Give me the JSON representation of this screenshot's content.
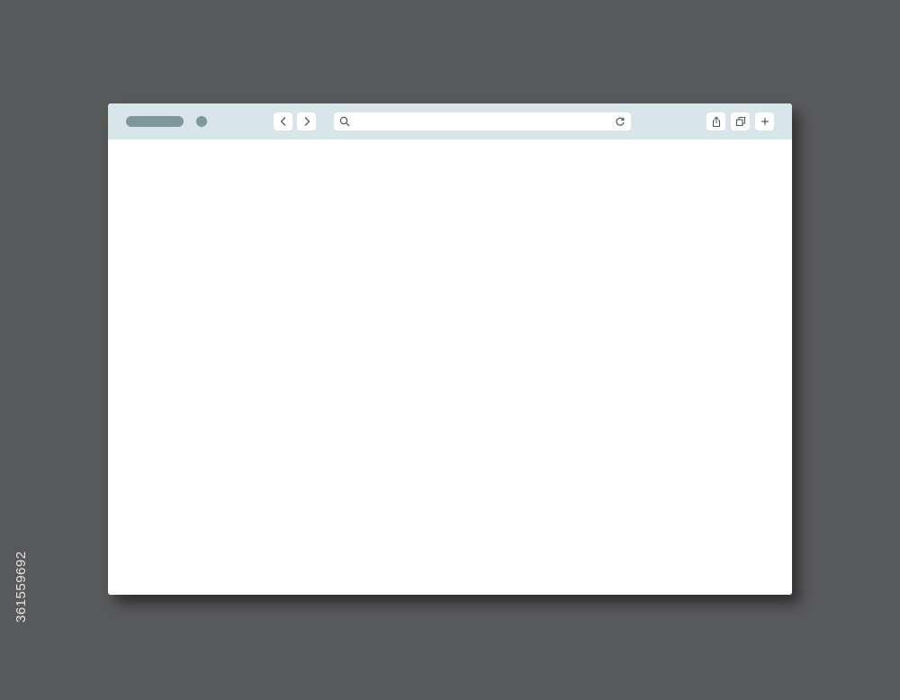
{
  "browser": {
    "address_bar": {
      "value": "",
      "placeholder": ""
    },
    "icons": {
      "back": "chevron-left-icon",
      "forward": "chevron-right-icon",
      "search": "search-icon",
      "reload": "reload-icon",
      "share": "share-icon",
      "tabs": "tabs-icon",
      "new_tab": "plus-icon"
    },
    "colors": {
      "background": "#58595b",
      "toolbar": "#d9e6e9",
      "accent": "#7e979b",
      "window": "#ffffff"
    }
  },
  "stock_id": "361559692"
}
